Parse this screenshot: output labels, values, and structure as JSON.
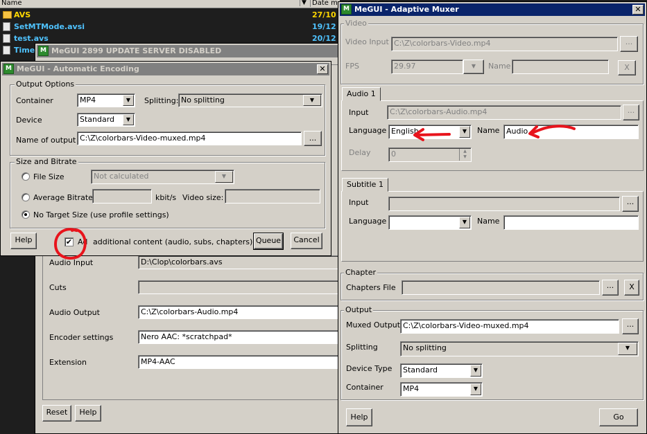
{
  "explorer": {
    "col_name": "Name",
    "col_date": "Date m",
    "rows": [
      {
        "name": "AVS",
        "date": "27/10",
        "kind": "folder"
      },
      {
        "name": "SetMTMode.avsi",
        "date": "19/12",
        "kind": "file"
      },
      {
        "name": "test.avs",
        "date": "20/12",
        "kind": "file"
      },
      {
        "name": "Time",
        "date": "",
        "kind": "file"
      }
    ]
  },
  "megui_main": {
    "title": "MeGUI 2899 UPDATE SERVER DISABLED",
    "audio_input_label": "Audio Input",
    "audio_input_value": "D:\\Clop\\colorbars.avs",
    "cuts_label": "Cuts",
    "cuts_value": "",
    "audio_output_label": "Audio Output",
    "audio_output_value": "C:\\Z\\colorbars-Audio.mp4",
    "encoder_settings_label": "Encoder settings",
    "encoder_settings_value": "Nero AAC: *scratchpad*",
    "extension_label": "Extension",
    "extension_value": "MP4-AAC",
    "reset_label": "Reset",
    "help_label": "Help"
  },
  "auto_encoding": {
    "title": "MeGUI - Automatic Encoding",
    "close": "✕",
    "output_options": "Output Options",
    "container_label": "Container",
    "container_value": "MP4",
    "splitting_label": "Splitting:",
    "splitting_value": "No splitting",
    "device_label": "Device",
    "device_value": "Standard",
    "name_of_output_label": "Name of output",
    "name_of_output_value": "C:\\Z\\colorbars-Video-muxed.mp4",
    "browse": "...",
    "size_bitrate": "Size and Bitrate",
    "file_size_label": "File Size",
    "file_size_value": "Not calculated",
    "avg_bitrate_label": "Average Bitrate",
    "kbits_label": "kbit/s",
    "video_size_label": "Video size:",
    "no_target_label": "No Target Size (use profile settings)",
    "help_label": "Help",
    "additional_label_start": "Ad",
    "additional_label_rest": "additional content (audio, subs, chapters)",
    "queue_label": "Queue",
    "cancel_label": "Cancel"
  },
  "muxer": {
    "title": "MeGUI - Adaptive Muxer",
    "close": "✕",
    "video_group": "Video",
    "video_input_label": "Video Input",
    "video_input_value": "C:\\Z\\colorbars-Video.mp4",
    "fps_label": "FPS",
    "fps_value": "29.97",
    "name_label": "Name",
    "remove": "X",
    "browse": "...",
    "audio_tab": "Audio 1",
    "audio_input_label": "Input",
    "audio_input_value": "C:\\Z\\colorbars-Audio.mp4",
    "language_label": "Language",
    "language_value": "English",
    "audio_name_label": "Name",
    "audio_name_value": "Audio",
    "delay_label": "Delay",
    "delay_value": "0",
    "subtitle_tab": "Subtitle 1",
    "sub_input_label": "Input",
    "sub_language_label": "Language",
    "sub_name_label": "Name",
    "chapter_group": "Chapter",
    "chapters_file_label": "Chapters File",
    "output_group": "Output",
    "muxed_output_label": "Muxed Output",
    "muxed_output_value": "C:\\Z\\colorbars-Video-muxed.mp4",
    "splitting_label": "Splitting",
    "splitting_value": "No splitting",
    "device_type_label": "Device Type",
    "device_type_value": "Standard",
    "container_label": "Container",
    "container_value": "MP4",
    "help_label": "Help",
    "go_label": "Go"
  },
  "colors": {
    "annotation": "#e8141c",
    "titlebar_active": "#0a246a",
    "explorer_text": "#4fc3ff",
    "folder_text": "#ffd700"
  }
}
